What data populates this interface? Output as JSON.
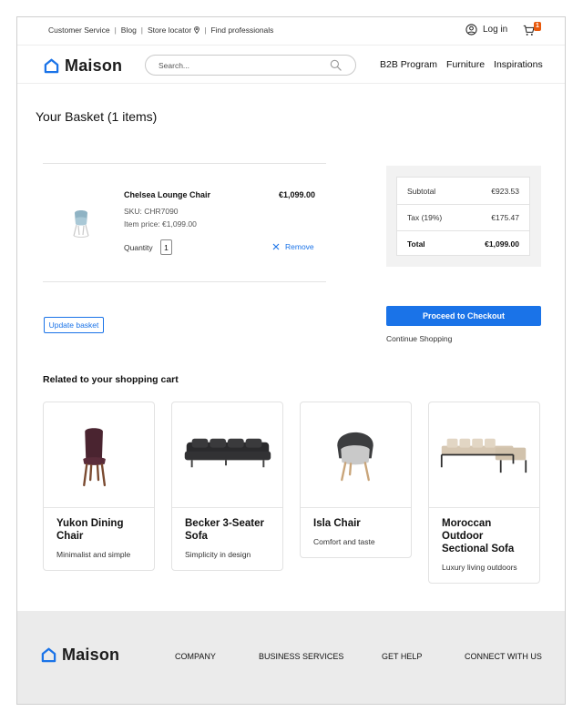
{
  "utility": {
    "links": [
      "Customer Service",
      "Blog",
      "Store locator",
      "Find professionals"
    ],
    "login_label": "Log in",
    "cart_count": "1"
  },
  "header": {
    "brand": "Maison",
    "search_placeholder": "Search...",
    "nav": [
      "B2B Program",
      "Furniture",
      "Inspirations"
    ]
  },
  "basket": {
    "title": "Your Basket (1 items)",
    "item": {
      "name": "Chelsea Lounge Chair",
      "price": "€1,099.00",
      "sku": "SKU: CHR7090",
      "unit_price": "Item price: €1,099.00",
      "quantity_label": "Quantity",
      "quantity": "1",
      "remove_label": "Remove"
    },
    "update_label": "Update basket"
  },
  "summary": {
    "rows": [
      {
        "label": "Subtotal",
        "value": "€923.53"
      },
      {
        "label": "Tax (19%)",
        "value": "€175.47"
      },
      {
        "label": "Total",
        "value": "€1,099.00"
      }
    ],
    "checkout_label": "Proceed to Checkout",
    "continue_label": "Continue Shopping"
  },
  "related": {
    "title": "Related to your shopping cart",
    "products": [
      {
        "name": "Yukon Dining Chair",
        "desc": "Minimalist and simple"
      },
      {
        "name": "Becker 3-Seater Sofa",
        "desc": "Simplicity in design"
      },
      {
        "name": "Isla Chair",
        "desc": "Comfort and taste"
      },
      {
        "name": "Moroccan Outdoor Sectional Sofa",
        "desc": "Luxury living outdoors"
      }
    ]
  },
  "footer": {
    "brand": "Maison",
    "columns": [
      "COMPANY",
      "BUSINESS SERVICES",
      "GET HELP",
      "CONNECT WITH US"
    ]
  },
  "colors": {
    "accent": "#1a73e8",
    "cart_badge": "#e8590c",
    "footer_bg": "#ebebeb"
  },
  "icons": [
    "location-pin-icon",
    "user-circle-icon",
    "cart-icon",
    "house-logo-icon",
    "search-icon",
    "close-icon"
  ]
}
